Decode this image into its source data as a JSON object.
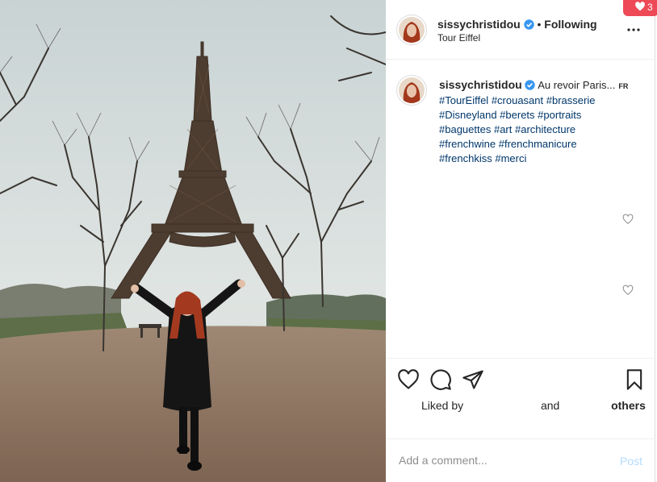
{
  "post": {
    "username": "sissychristidou",
    "follow_status": "Following",
    "separator": "•",
    "location": "Tour Eiffel"
  },
  "caption": {
    "username": "sissychristidou",
    "text": "Au revoir Paris...",
    "translate_badge": "FR",
    "hashtags": [
      "#TourEiffel",
      "#crouasant",
      "#brasserie",
      "#Disneyland",
      "#berets",
      "#portraits",
      "#baguettes",
      "#art",
      "#architecture",
      "#frenchwine",
      "#frenchmanicure",
      "#frenchkiss",
      "#merci"
    ]
  },
  "likes": {
    "prefix": "Liked by",
    "and": "and",
    "others": "others"
  },
  "comment": {
    "placeholder": "Add a comment...",
    "post_label": "Post"
  },
  "notification": {
    "count": "3"
  },
  "icons": {
    "more": "more-options-icon",
    "like": "heart-icon",
    "comment": "comment-icon",
    "share": "paper-plane-icon",
    "save": "bookmark-icon",
    "verified": "verified-badge-icon"
  },
  "colors": {
    "hashtag": "#00376b",
    "verified": "#3897f0",
    "post_disabled": "#b3dbff",
    "notification": "#ed4956"
  }
}
